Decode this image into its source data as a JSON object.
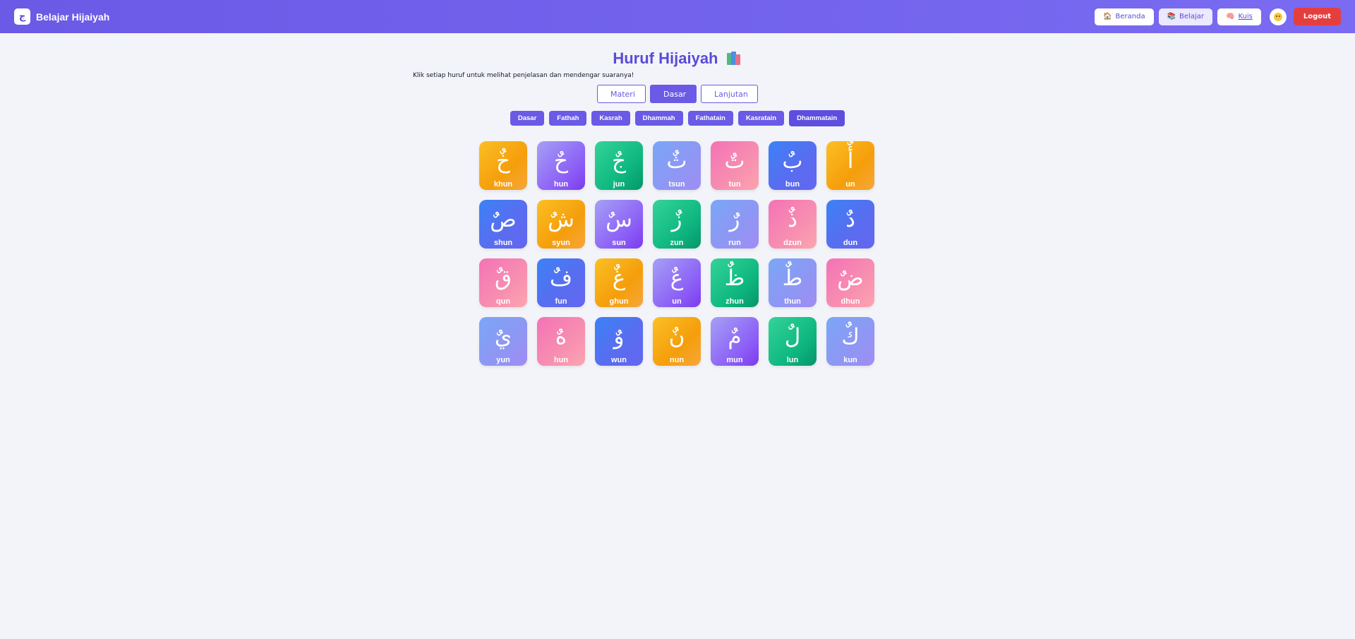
{
  "navbar": {
    "logo_glyph": "ج",
    "title": "Belajar Hijaiyah",
    "links": [
      {
        "icon": "🏠",
        "label": "Beranda",
        "active": false,
        "underline": false
      },
      {
        "icon": "📚",
        "label": "Belajar",
        "active": true,
        "underline": false
      },
      {
        "icon": "🧠",
        "label": "Kuis",
        "active": false,
        "underline": true
      }
    ],
    "avatar_icon": "smiley-face",
    "logout_label": "Logout"
  },
  "page": {
    "title": "Huruf Hijaiyah",
    "title_icon": "books-icon",
    "subtitle": "Klik setiap huruf untuk melihat penjelasan dan mendengar suaranya!"
  },
  "tabs": [
    {
      "label": "Materi",
      "active": false
    },
    {
      "label": "Dasar",
      "active": true
    },
    {
      "label": "Lanjutan",
      "active": false
    }
  ],
  "filters": [
    {
      "label": "Dasar",
      "active": false
    },
    {
      "label": "Fathah",
      "active": false
    },
    {
      "label": "Kasrah",
      "active": false
    },
    {
      "label": "Dhammah",
      "active": false
    },
    {
      "label": "Fathatain",
      "active": false
    },
    {
      "label": "Kasratain",
      "active": false
    },
    {
      "label": "Dhammatain",
      "active": true
    }
  ],
  "colors": {
    "brand": "#6a5ae6",
    "logout": "#e53e3e",
    "background": "#f3f4f9"
  },
  "letters": [
    {
      "glyph": "خٌ",
      "latin": "khun",
      "color": "orange"
    },
    {
      "glyph": "حٌ",
      "latin": "hun",
      "color": "purple"
    },
    {
      "glyph": "جٌ",
      "latin": "jun",
      "color": "green"
    },
    {
      "glyph": "ثٌ",
      "latin": "tsun",
      "color": "lblue"
    },
    {
      "glyph": "تٌ",
      "latin": "tun",
      "color": "pink"
    },
    {
      "glyph": "بٌ",
      "latin": "bun",
      "color": "blue"
    },
    {
      "glyph": "أٌ",
      "latin": "un",
      "color": "orange"
    },
    {
      "glyph": "صٌ",
      "latin": "shun",
      "color": "blue"
    },
    {
      "glyph": "شٌ",
      "latin": "syun",
      "color": "orange"
    },
    {
      "glyph": "سٌ",
      "latin": "sun",
      "color": "purple"
    },
    {
      "glyph": "زٌ",
      "latin": "zun",
      "color": "green"
    },
    {
      "glyph": "رٌ",
      "latin": "run",
      "color": "lblue"
    },
    {
      "glyph": "ذٌ",
      "latin": "dzun",
      "color": "pink"
    },
    {
      "glyph": "دٌ",
      "latin": "dun",
      "color": "blue"
    },
    {
      "glyph": "قٌ",
      "latin": "qun",
      "color": "pink"
    },
    {
      "glyph": "فٌ",
      "latin": "fun",
      "color": "blue"
    },
    {
      "glyph": "غٌ",
      "latin": "ghun",
      "color": "orange"
    },
    {
      "glyph": "عٌ",
      "latin": "un",
      "color": "purple"
    },
    {
      "glyph": "ظٌ",
      "latin": "zhun",
      "color": "green"
    },
    {
      "glyph": "طٌ",
      "latin": "thun",
      "color": "lblue"
    },
    {
      "glyph": "ضٌ",
      "latin": "dhun",
      "color": "pink"
    },
    {
      "glyph": "يٌ",
      "latin": "yun",
      "color": "lblue"
    },
    {
      "glyph": "هٌ",
      "latin": "hun",
      "color": "pink"
    },
    {
      "glyph": "وٌ",
      "latin": "wun",
      "color": "blue"
    },
    {
      "glyph": "نٌ",
      "latin": "nun",
      "color": "orange"
    },
    {
      "glyph": "مٌ",
      "latin": "mun",
      "color": "purple"
    },
    {
      "glyph": "لٌ",
      "latin": "lun",
      "color": "green"
    },
    {
      "glyph": "كٌ",
      "latin": "kun",
      "color": "lblue"
    }
  ]
}
